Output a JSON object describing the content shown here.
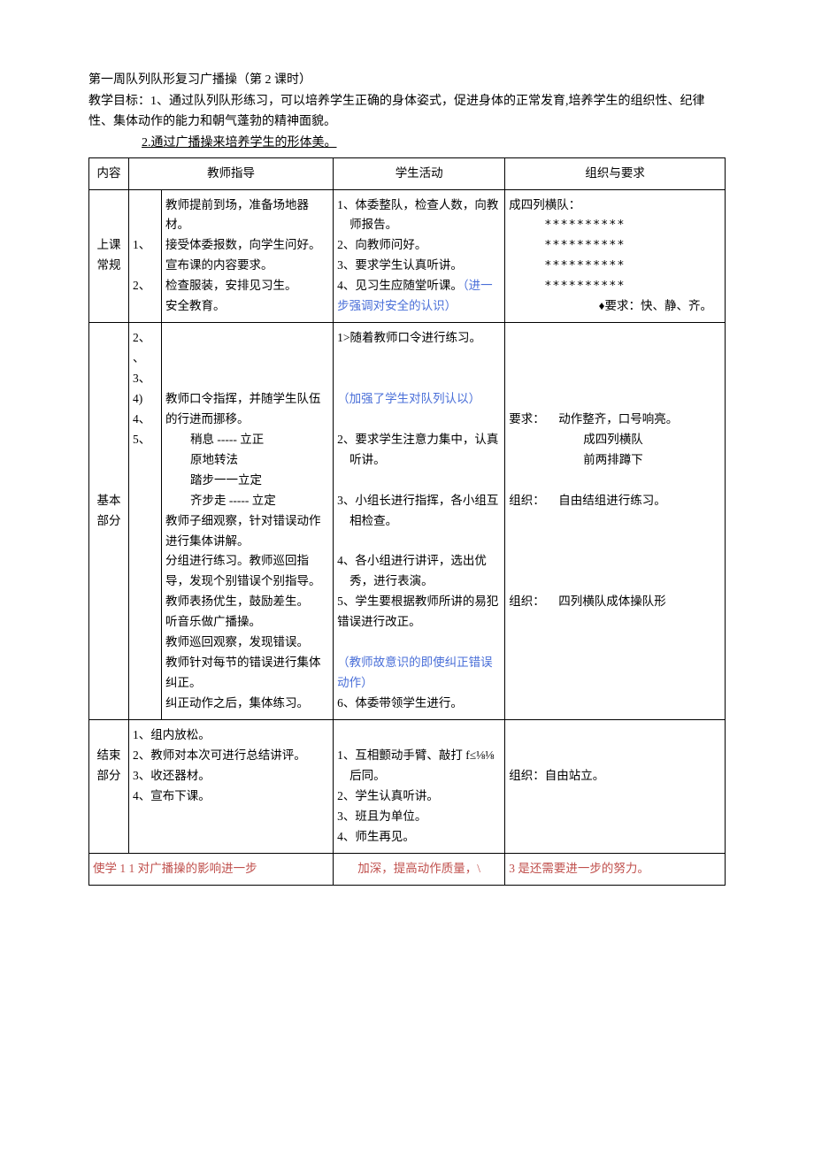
{
  "header": {
    "line1": "第一周队列队形复习广播操（第 2 课时）",
    "line2": "教学目标：1、通过队列队形练习，可以培养学生正确的身体姿式，促进身体的正常发育,培养学生的组织性、纪律性、集体动作的能力和朝气蓬勃的精神面貌。",
    "line3": "2.通过广播操来培养学生的形体美。"
  },
  "table_header": {
    "c1": "内容",
    "c2": "教师指导",
    "c3": "学生活动",
    "c4": "组织与要求"
  },
  "row1": {
    "section": "上课常规",
    "num": "1、\n\n2、",
    "teacher": "教师提前到场，准备场地器材。\n接受体委报数，向学生问好。\n宣布课的内容要求。\n检查服装，安排见习生。\n安全教育。",
    "student_items": [
      "1、体委整队，检查人数，向教师报告。",
      "2、向教师问好。",
      "",
      "3、要求学生认真听讲。",
      "4、见习生应随堂听课。"
    ],
    "student_blue": "（进一步强调对安全的认识）",
    "org_title": "成四列横队：",
    "org_stars": "**********",
    "org_req": "♦要求：快、静、齐。"
  },
  "row2": {
    "section": "基本部分",
    "num": "2、\n、\n3、\n4)\n4、\n5、",
    "teacher_lines": [
      "教师口令指挥，并随学生队伍的行进而挪移。",
      "稍息 ----- 立正",
      "原地转法",
      "踏步一一立定",
      "齐步走 ----- 立定",
      "教师子细观察，针对错误动作进行集体讲解。",
      "分组进行练习。教师巡回指导，发现个别错误个别指导。",
      "教师表扬优生，鼓励差生。",
      "听音乐做广播操。",
      "教师巡回观察，发现错误。",
      "教师针对每节的错误进行集体纠正。",
      "纠正动作之后，集体练习。"
    ],
    "student_s1": "1>随着教师口令进行练习。",
    "student_blue1": "（加强了学生对队列认以）",
    "student_s2": "2、要求学生注意力集中，认真听讲。",
    "student_s3": "3、小组长进行指挥，各小组互相检查。",
    "student_s4": "4、各小组进行讲评，选出优秀，进行表演。",
    "student_s5": "5、学生要根据教师所讲的易犯错误进行改正。",
    "student_blue2": "（教师故意识的即使纠正错误动作）",
    "student_s6": "6、体委带领学生进行。",
    "org_label1": "要求：",
    "org_text1a": "动作整齐，口号响亮。",
    "org_text1b": "成四列横队",
    "org_text1c": "前两排蹲下",
    "org_label2": "组织：",
    "org_text2": "自由结组进行练习。",
    "org_label3": "组织：",
    "org_text3": "四列横队成体操队形"
  },
  "row3": {
    "section": "结束部分",
    "teacher_lines": [
      "1、组内放松。",
      "2、教师对本次可进行总结讲评。",
      "3、收还器材。",
      "4、宣布下课。"
    ],
    "student_lines": [
      "1、互相颤动手臂、敲打 f≤⅛⅛后同。",
      "2、学生认真听讲。",
      "3、班且为单位。",
      "4、师生再见。"
    ],
    "org": "组织：自由站立。"
  },
  "footer": {
    "left": "使学 1 1 对广播操的影响进一步",
    "mid": "加深，提高动作质量，\\",
    "right": "3 是还需要进一步的努力。"
  }
}
